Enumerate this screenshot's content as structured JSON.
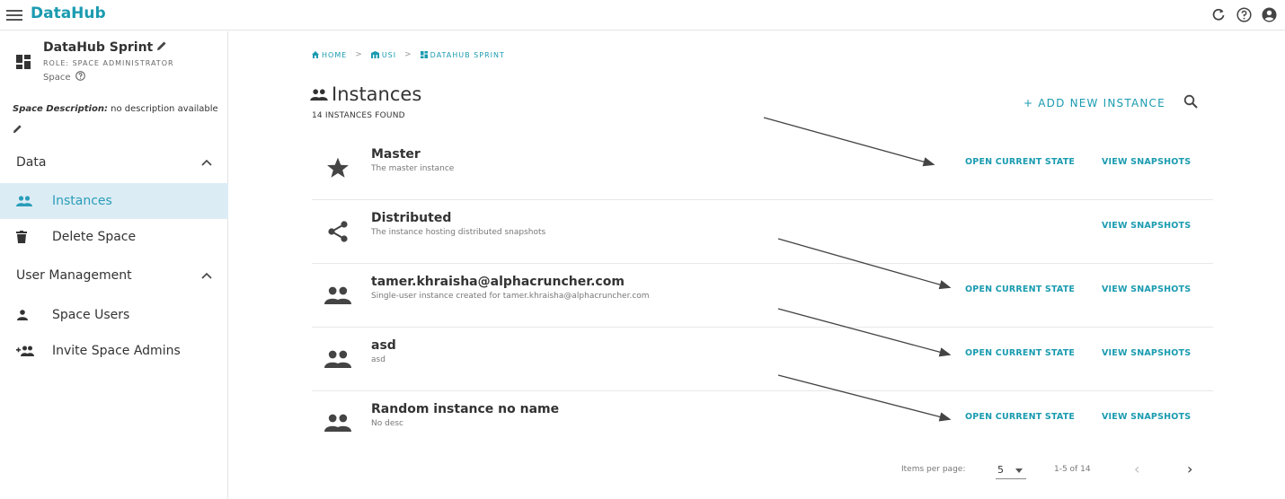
{
  "app": {
    "title": "DataHub"
  },
  "space": {
    "name": "DataHub Sprint",
    "role": "ROLE: SPACE ADMINISTRATOR",
    "type": "Space",
    "description_label": "Space Description:",
    "description": " no description available"
  },
  "sidebar": {
    "data_section": "Data",
    "user_section": "User Management",
    "items": [
      {
        "label": "Instances",
        "icon": "people-icon"
      },
      {
        "label": "Delete Space",
        "icon": "trash-icon"
      },
      {
        "label": "Space Users",
        "icon": "person-icon"
      },
      {
        "label": "Invite Space Admins",
        "icon": "group-add-icon"
      }
    ]
  },
  "breadcrumb": {
    "home": "HOME",
    "usi": "USI",
    "space": "DATAHUB SPRINT"
  },
  "main": {
    "title": "Instances",
    "count": "14 INSTANCES FOUND",
    "add_label": "+ ADD NEW INSTANCE"
  },
  "instances": [
    {
      "name": "Master",
      "desc": "The master instance",
      "icon": "star-icon",
      "open": "OPEN CURRENT STATE",
      "snap": "VIEW SNAPSHOTS"
    },
    {
      "name": "Distributed",
      "desc": "The instance hosting distributed snapshots",
      "icon": "share-icon",
      "open": "",
      "snap": "VIEW SNAPSHOTS"
    },
    {
      "name": "tamer.khraisha@alphacruncher.com",
      "desc": "Single-user instance created for tamer.khraisha@alphacruncher.com",
      "icon": "people-icon",
      "open": "OPEN CURRENT STATE",
      "snap": "VIEW SNAPSHOTS"
    },
    {
      "name": "asd",
      "desc": "asd",
      "icon": "people-icon",
      "open": "OPEN CURRENT STATE",
      "snap": "VIEW SNAPSHOTS"
    },
    {
      "name": "Random instance no name",
      "desc": "No desc",
      "icon": "people-icon",
      "open": "OPEN CURRENT STATE",
      "snap": "VIEW SNAPSHOTS"
    }
  ],
  "pager": {
    "label": "Items per page:",
    "per_page": "5",
    "range": "1-5 of 14"
  },
  "colors": {
    "accent": "#1a9bb0",
    "active_bg": "#dcecf4"
  }
}
